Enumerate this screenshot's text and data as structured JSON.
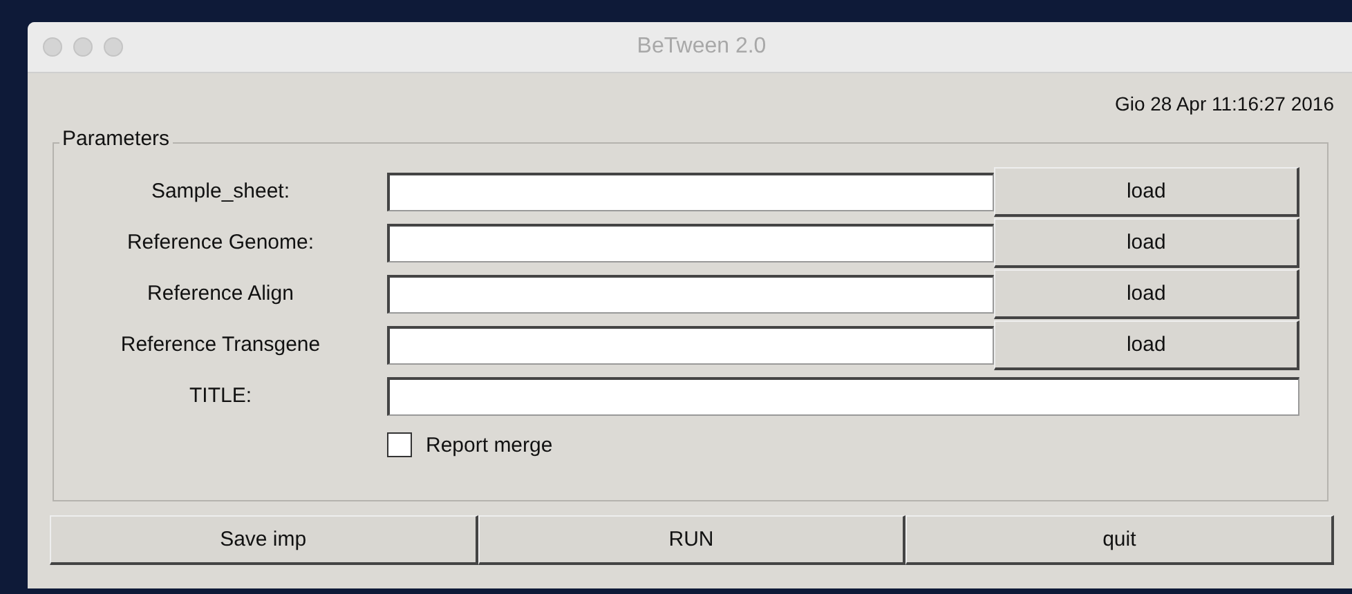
{
  "window": {
    "title": "BeTween 2.0"
  },
  "datetime": "Gio 28 Apr 11:16:27 2016",
  "parameters": {
    "title": "Parameters",
    "rows": [
      {
        "label": "Sample_sheet:",
        "kind": "file",
        "button": "load"
      },
      {
        "label": "Reference Genome:",
        "kind": "file",
        "button": "load"
      },
      {
        "label": "Reference Align",
        "kind": "file",
        "button": "load"
      },
      {
        "label": "Reference Transgene",
        "kind": "file",
        "button": "load"
      },
      {
        "label": "TITLE:",
        "kind": "text"
      }
    ],
    "checkbox": {
      "label": "Report merge",
      "checked": false
    }
  },
  "buttons": [
    "Save imp",
    "RUN",
    "quit"
  ]
}
